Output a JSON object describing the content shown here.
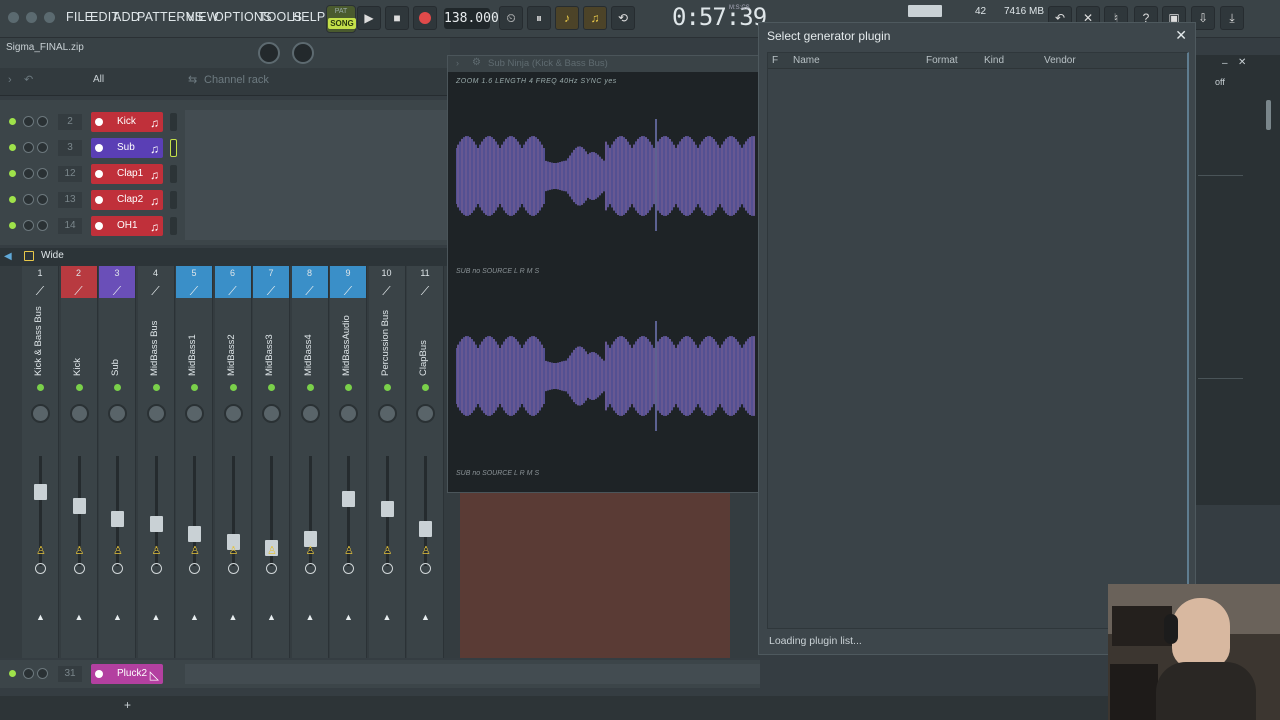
{
  "menu": [
    "FILE",
    "EDIT",
    "ADD",
    "PATTERNS",
    "VIEW",
    "OPTIONS",
    "TOOLS",
    "HELP"
  ],
  "transport": {
    "pat_label": "PAT",
    "song_label": "SONG",
    "play_icon": "play-icon",
    "stop_icon": "stop-icon",
    "record_icon": "record-icon",
    "tempo": "138.000",
    "time": "0:57:39",
    "time_sub": "M:S:CS"
  },
  "system": {
    "cpu_value": "42",
    "memory": "7416 MB"
  },
  "project": {
    "name": "Sigma_FINAL.zip"
  },
  "browser": {
    "filter": "All",
    "panel_title": "Channel rack"
  },
  "channels": [
    {
      "num": "2",
      "name": "Kick",
      "color": "#c0303a"
    },
    {
      "num": "3",
      "name": "Sub",
      "color": "#5a3fb5"
    },
    {
      "num": "12",
      "name": "Clap1",
      "color": "#c0303a"
    },
    {
      "num": "13",
      "name": "Clap2",
      "color": "#c0303a"
    },
    {
      "num": "14",
      "name": "OH1",
      "color": "#c0303a"
    }
  ],
  "bottom_channel": {
    "num": "31",
    "name": "Pluck2",
    "color": "#b340a0"
  },
  "mixer": {
    "preset": "Wide",
    "strips": [
      {
        "num": "1",
        "name": "Kick & Bass Bus",
        "color": "#3a4347",
        "fader": 0.72
      },
      {
        "num": "2",
        "name": "Kick",
        "color": "#b83a40",
        "fader": 0.58
      },
      {
        "num": "3",
        "name": "Sub",
        "color": "#6a4fb8",
        "fader": 0.45
      },
      {
        "num": "4",
        "name": "MidBass Bus",
        "color": "#3a4347",
        "fader": 0.4
      },
      {
        "num": "5",
        "name": "MidBass1",
        "color": "#3a8fc8",
        "fader": 0.3
      },
      {
        "num": "6",
        "name": "MidBass2",
        "color": "#3a8fc8",
        "fader": 0.22
      },
      {
        "num": "7",
        "name": "MidBass3",
        "color": "#3a8fc8",
        "fader": 0.16
      },
      {
        "num": "8",
        "name": "MidBass4",
        "color": "#3a8fc8",
        "fader": 0.25
      },
      {
        "num": "9",
        "name": "MidBassAudio",
        "color": "#3a8fc8",
        "fader": 0.65
      },
      {
        "num": "10",
        "name": "Percussion Bus",
        "color": "#3a4347",
        "fader": 0.55
      },
      {
        "num": "11",
        "name": "ClapBus",
        "color": "#3a4347",
        "fader": 0.35
      }
    ]
  },
  "plugin_window": {
    "title": "Sub Ninja (Kick & Bass Bus)",
    "info": "ZOOM  1.6  LENGTH  4  FREQ  40Hz  SYNC  yes",
    "label_1": "SUB  no  SOURCE  L R M S",
    "label_2": "SUB  no  SOURCE  L R M S"
  },
  "dialog": {
    "title": "Select generator plugin",
    "columns": [
      "F",
      "Name",
      "Format",
      "Kind",
      "Vendor"
    ],
    "status": "Loading plugin list..."
  },
  "right_panel": {
    "off_label": "off"
  }
}
